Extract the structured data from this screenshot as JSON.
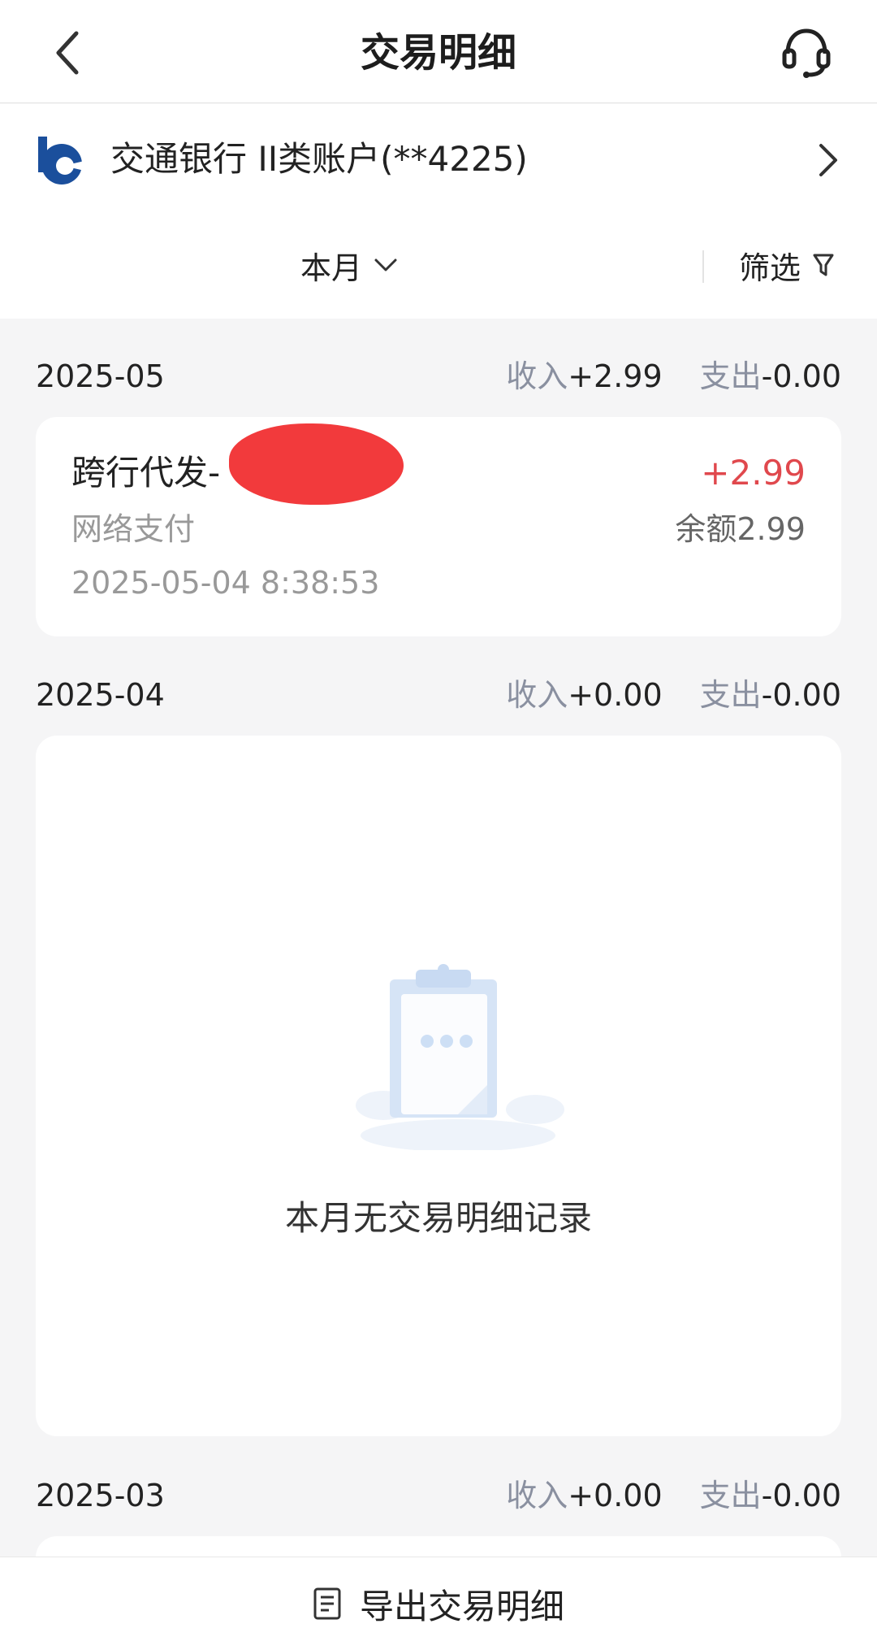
{
  "header": {
    "title": "交易明细",
    "back_icon": "chevron-left-icon",
    "service_icon": "headset-icon"
  },
  "account": {
    "name": "交通银行 II类账户(**4225)",
    "logo_icon": "bank-logo",
    "brand_color": "#1b4f9c"
  },
  "filter": {
    "month_label": "本月",
    "filter_label": "筛选"
  },
  "months": [
    {
      "month": "2025-05",
      "income_label": "收入",
      "income_value": "+2.99",
      "expense_label": "支出",
      "expense_value": "-0.00",
      "transactions": [
        {
          "name": "跨行代发-",
          "amount": "+2.99",
          "channel": "网络支付",
          "balance": "余额2.99",
          "time": "2025-05-04 8:38:53"
        }
      ]
    },
    {
      "month": "2025-04",
      "income_label": "收入",
      "income_value": "+0.00",
      "expense_label": "支出",
      "expense_value": "-0.00",
      "empty_text": "本月无交易明细记录"
    },
    {
      "month": "2025-03",
      "income_label": "收入",
      "income_value": "+0.00",
      "expense_label": "支出",
      "expense_value": "-0.00"
    }
  ],
  "bottom": {
    "export_label": "导出交易明细",
    "export_icon": "document-icon"
  },
  "colors": {
    "income_amount": "#e0484d",
    "muted": "#8a90a0",
    "background": "#f5f5f6"
  }
}
